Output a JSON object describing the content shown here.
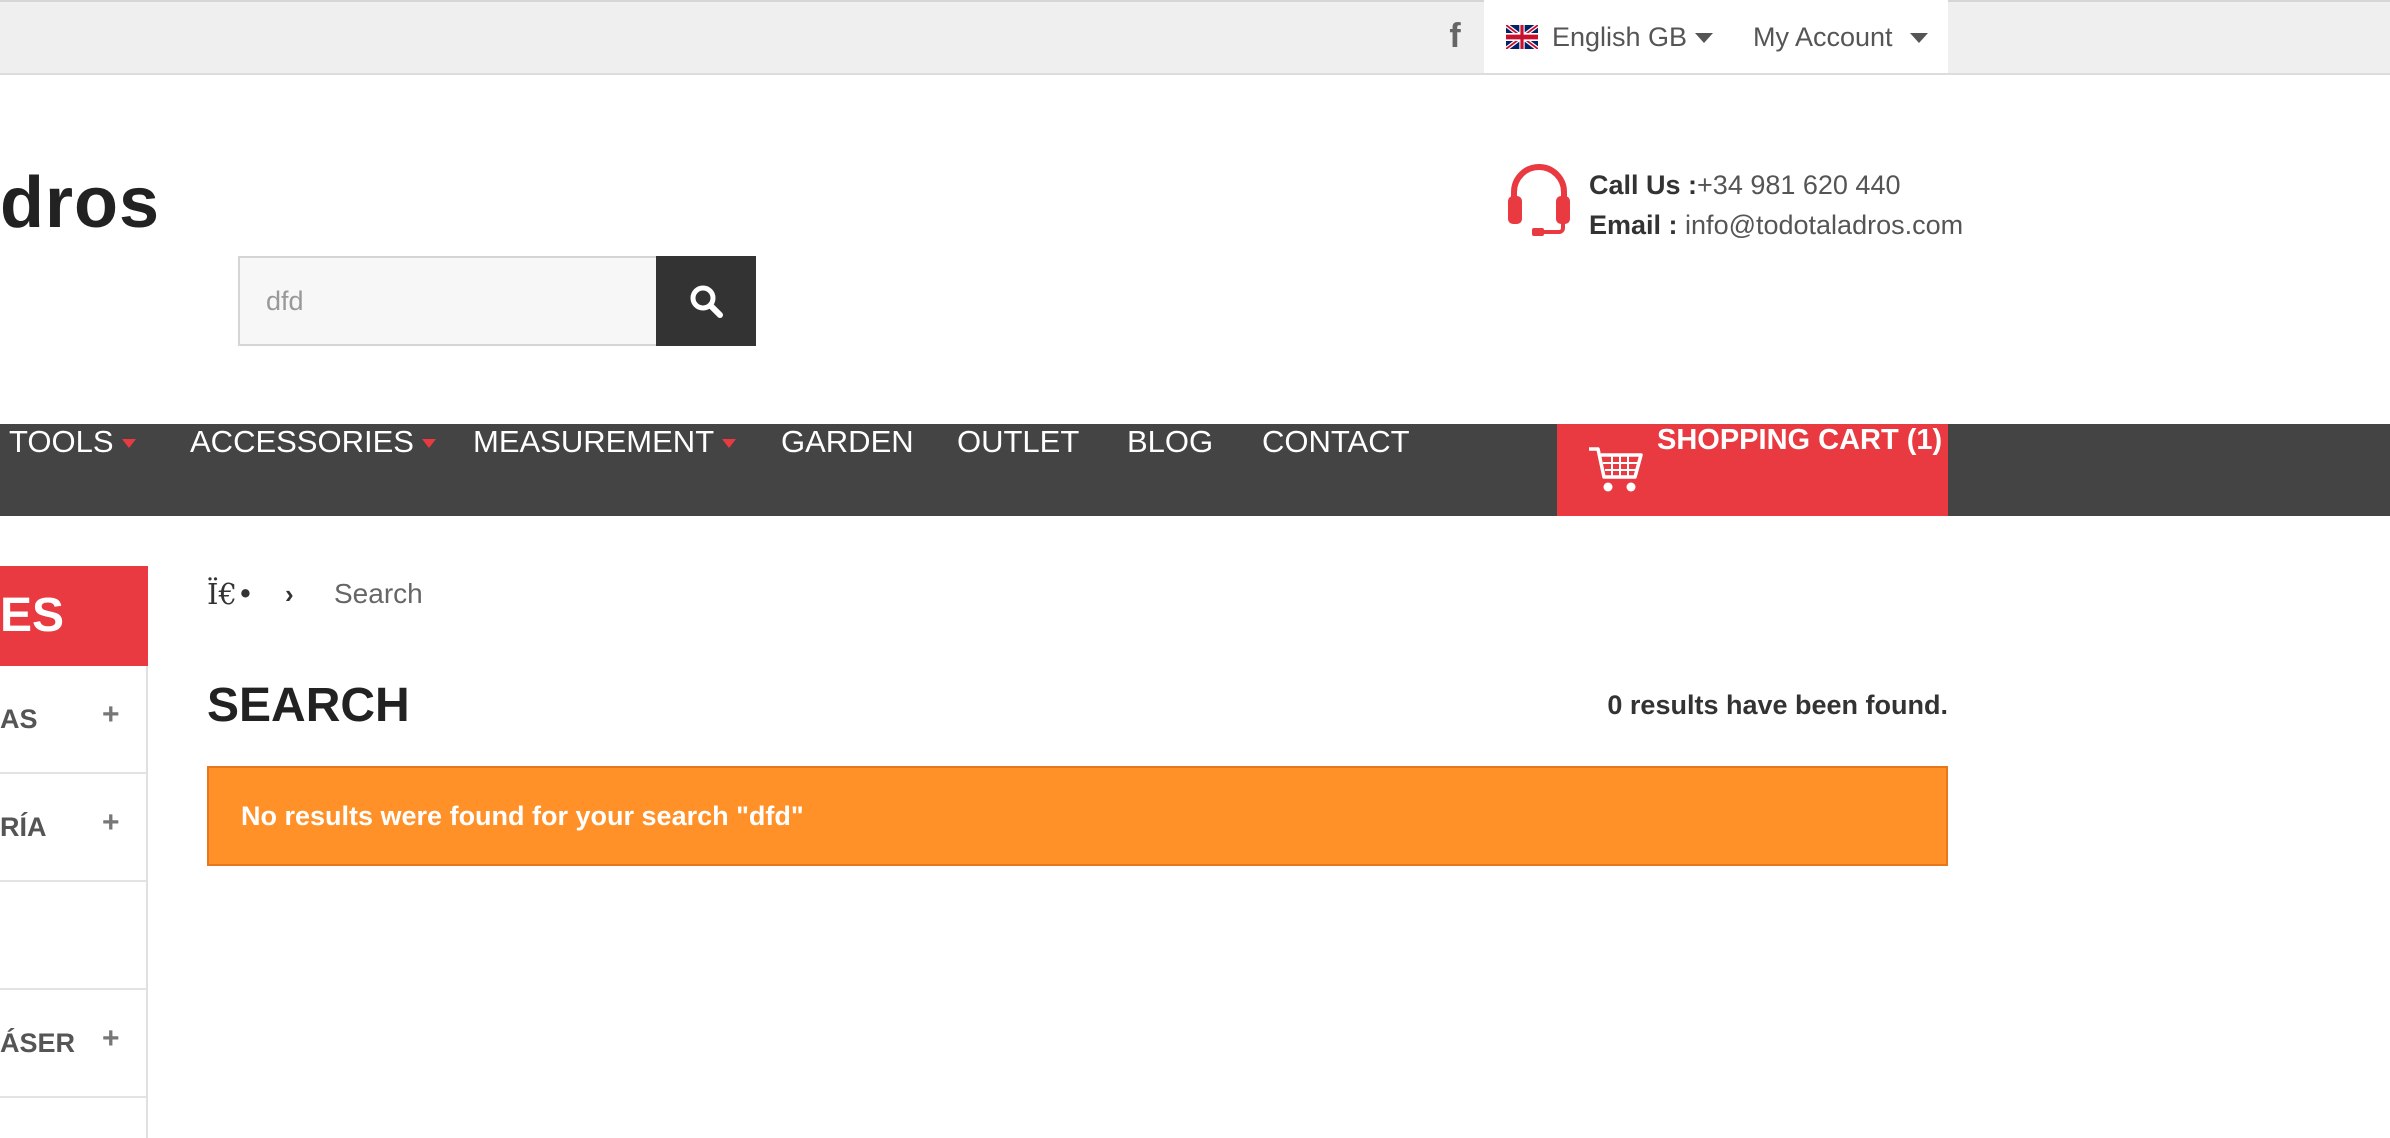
{
  "topbar": {
    "facebook_icon": "f",
    "language": "English GB",
    "account": "My Account"
  },
  "header": {
    "logo_text": "dros",
    "search": {
      "value": "dfd",
      "placeholder": ""
    },
    "call_label": "Call Us :",
    "phone": "+34 981 620 440",
    "email_label": "Email :",
    "email": "info@todotaladros.com"
  },
  "nav": {
    "items": [
      {
        "label": "TOOLS",
        "dropdown": true
      },
      {
        "label": "ACCESSORIES",
        "dropdown": true
      },
      {
        "label": "MEASUREMENT",
        "dropdown": true
      },
      {
        "label": "GARDEN",
        "dropdown": false
      },
      {
        "label": "OUTLET",
        "dropdown": false
      },
      {
        "label": "BLOG",
        "dropdown": false
      },
      {
        "label": "CONTACT",
        "dropdown": false
      }
    ],
    "cart_label": "SHOPPING CART (1)"
  },
  "sidebar": {
    "heading": "ES",
    "items": [
      {
        "label": "AS",
        "expandable": true
      },
      {
        "label": "RÍA",
        "expandable": true
      },
      {
        "label": "",
        "expandable": false
      },
      {
        "label": "ÁSER",
        "expandable": true
      }
    ]
  },
  "breadcrumb": {
    "home": "Ï€•",
    "separator": "›",
    "current": "Search"
  },
  "main": {
    "title": "SEARCH",
    "result_count": "0 results have been found.",
    "alert": "No results were found for your search \"dfd\""
  },
  "colors": {
    "accent_red": "#e83a40",
    "nav_bg": "#444444",
    "alert_orange": "#ff9128"
  }
}
